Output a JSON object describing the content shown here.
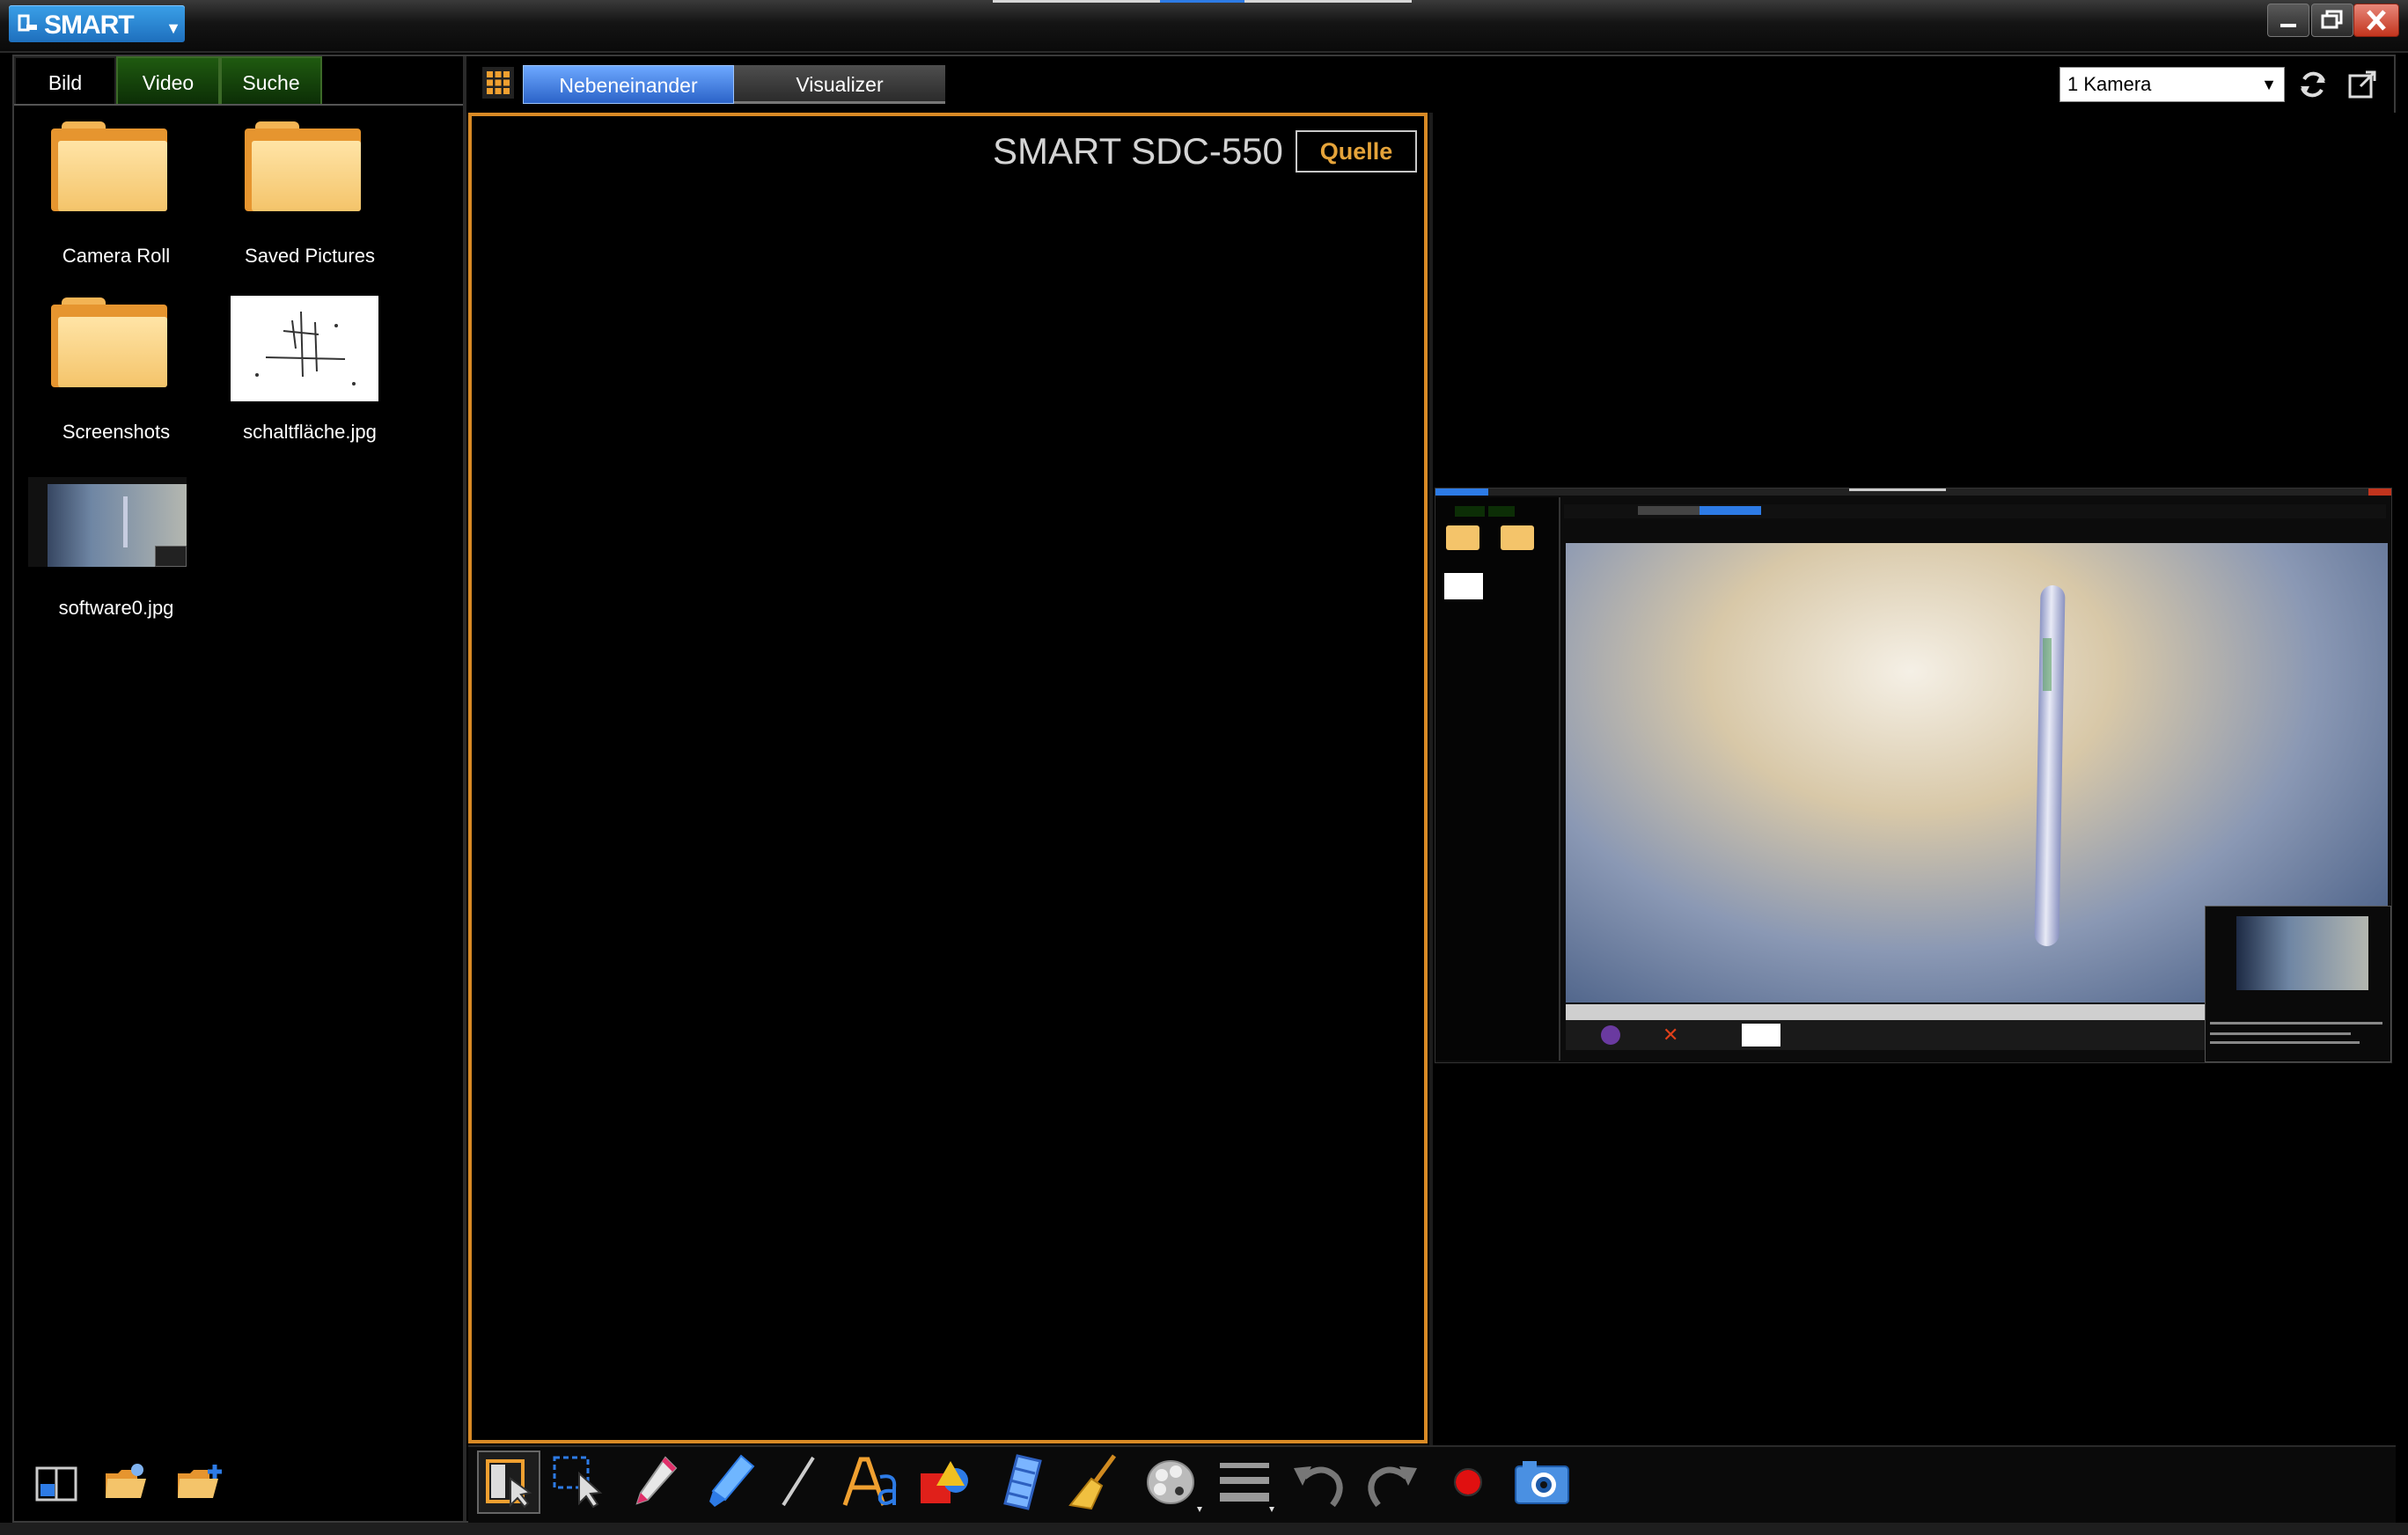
{
  "app": {
    "logo_text": "SMART",
    "window_buttons": [
      "minimize-icon",
      "restore-icon",
      "close-icon"
    ]
  },
  "left_panel": {
    "tabs": [
      {
        "label": "Bild",
        "active": true
      },
      {
        "label": "Video",
        "active": false
      },
      {
        "label": "Suche",
        "active": false
      }
    ],
    "items": [
      {
        "label": "Camera Roll",
        "type": "folder"
      },
      {
        "label": "Saved Pictures",
        "type": "folder"
      },
      {
        "label": "Screenshots",
        "type": "folder"
      },
      {
        "label": "schaltfläche.jpg",
        "type": "image"
      },
      {
        "label": "software0.jpg",
        "type": "image"
      }
    ],
    "bottom_icons": [
      "layout-icon",
      "folder-open-icon",
      "folder-add-icon"
    ]
  },
  "main": {
    "view_toggle": {
      "nebeneinander": "Nebeneinander",
      "visualizer": "Visualizer",
      "active": "Nebeneinander"
    },
    "camera_select": {
      "value": "1 Kamera"
    },
    "camera_title": "SMART SDC-550",
    "quelle_label": "Quelle"
  },
  "toolbar": {
    "tools": [
      "select-mode-icon",
      "area-select-icon",
      "pen-icon",
      "highlighter-icon",
      "line-icon",
      "text-icon",
      "shapes-icon",
      "eraser-icon",
      "clear-icon",
      "color-palette-icon",
      "line-width-icon",
      "undo-icon",
      "redo-icon",
      "record-icon",
      "camera-icon"
    ]
  },
  "colors": {
    "accent_orange": "#d98a25",
    "accent_blue": "#2b63c8",
    "tab_green": "#1f5a10",
    "record_red": "#e01010"
  }
}
